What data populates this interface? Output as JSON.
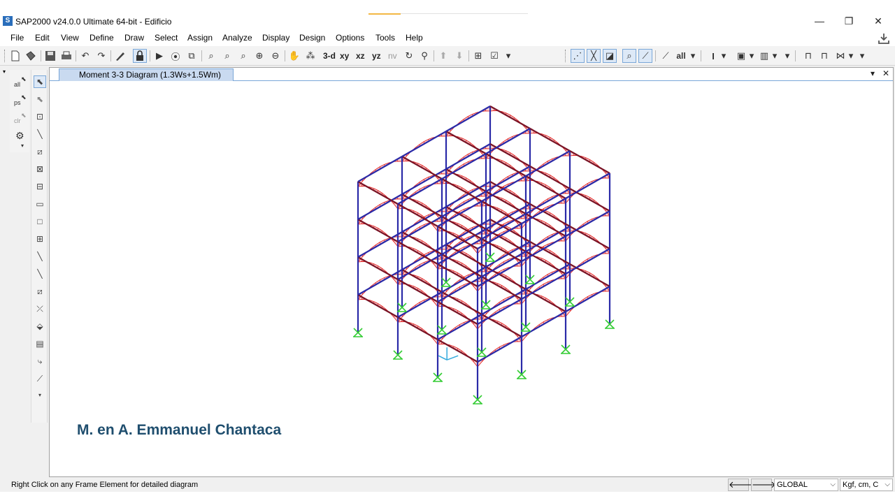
{
  "window": {
    "app_icon_letter": "S",
    "title": "SAP2000 v24.0.0 Ultimate 64-bit - Edificio",
    "minimize": "—",
    "restore": "❐",
    "close": "✕"
  },
  "menu": [
    "File",
    "Edit",
    "View",
    "Define",
    "Draw",
    "Select",
    "Assign",
    "Analyze",
    "Display",
    "Design",
    "Options",
    "Tools",
    "Help"
  ],
  "toolbar": {
    "view_3d": "3-d",
    "view_xy": "xy",
    "view_xz": "xz",
    "view_yz": "yz",
    "view_nv": "nv"
  },
  "left_tools": {
    "select_all": "all",
    "select_ps": "ps",
    "select_clr": "clr"
  },
  "document": {
    "tab_title": "Moment 3-3 Diagram (1.3Ws+1.5Wm)",
    "watermark": "M. en A. Emmanuel Chantaca"
  },
  "status": {
    "message": "Right Click on any Frame Element for detailed diagram",
    "coord_system": "GLOBAL",
    "units": "Kgf, cm, C"
  },
  "colors": {
    "frame_blue": "#2a2aa8",
    "beam_dark_red": "#7a1426",
    "moment_red": "#e01010",
    "support_green": "#33cc33",
    "label_blue": "#3636b0"
  },
  "icons": [
    "new-model-icon",
    "open-icon",
    "save-icon",
    "print-icon",
    "undo-icon",
    "redo-icon",
    "pencil-icon",
    "lock-icon",
    "run-icon",
    "pan-icon",
    "zoom-icon",
    "download-icon"
  ]
}
